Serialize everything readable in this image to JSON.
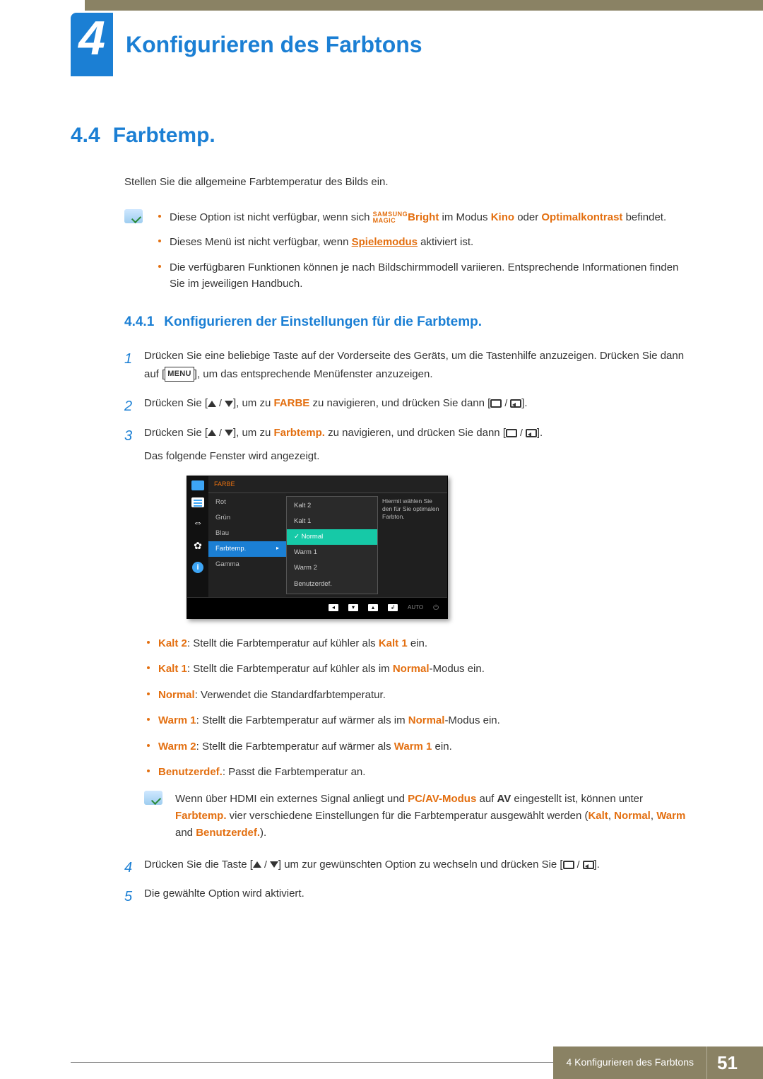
{
  "chapter": {
    "number": "4",
    "title": "Konfigurieren des Farbtons"
  },
  "section": {
    "number": "4.4",
    "title": "Farbtemp."
  },
  "intro": "Stellen Sie die allgemeine Farbtemperatur des Bilds ein.",
  "brand": {
    "samsung": "SAMSUNG",
    "magic": "MAGIC",
    "bright": "Bright"
  },
  "notes": {
    "n1a": "Diese Option ist nicht verfügbar, wenn sich ",
    "n1b": " im Modus ",
    "n1_kino": "Kino",
    "n1_or": " oder ",
    "n1_opt": "Optimalkontrast",
    "n1c": " befindet.",
    "n2a": "Dieses Menü ist nicht verfügbar, wenn ",
    "n2_game": "Spielemodus",
    "n2b": " aktiviert ist.",
    "n3": "Die verfügbaren Funktionen können je nach Bildschirmmodell variieren. Entsprechende Informationen finden Sie im jeweiligen Handbuch."
  },
  "subsection": {
    "number": "4.4.1",
    "title": "Konfigurieren der Einstellungen für die Farbtemp."
  },
  "steps": {
    "s1a": "Drücken Sie eine beliebige Taste auf der Vorderseite des Geräts, um die Tastenhilfe anzuzeigen. Drücken Sie dann auf [",
    "s1_menu": "MENU",
    "s1b": "], um das entsprechende Menüfenster anzuzeigen.",
    "s2a": "Drücken Sie [",
    "s2b": "], um zu ",
    "s2_farbe": "FARBE",
    "s2c": " zu navigieren, und drücken Sie dann [",
    "s2d": "].",
    "s3a": "Drücken Sie [",
    "s3b": "], um zu ",
    "s3_farbtemp": "Farbtemp.",
    "s3c": " zu navigieren, und drücken Sie dann [",
    "s3d": "].",
    "s3e": "Das folgende Fenster wird angezeigt.",
    "s4a": "Drücken Sie die Taste [",
    "s4b": "] um zur gewünschten Option zu wechseln und drücken Sie [",
    "s4c": "].",
    "s5": "Die gewählte Option wird aktiviert."
  },
  "osd": {
    "title": "FARBE",
    "left": [
      "Rot",
      "Grün",
      "Blau",
      "Farbtemp.",
      "Gamma"
    ],
    "mid": [
      "Kalt 2",
      "Kalt 1",
      "Normal",
      "Warm 1",
      "Warm 2",
      "Benutzerdef."
    ],
    "help": "Hiermit wählen Sie den für Sie optimalen Farbton.",
    "auto": "AUTO"
  },
  "options": {
    "kalt2_l": "Kalt 2",
    "kalt2_t": ": Stellt die Farbtemperatur auf kühler als ",
    "kalt2_r": "Kalt 1",
    "kalt2_e": " ein.",
    "kalt1_l": "Kalt 1",
    "kalt1_t": ": Stellt die Farbtemperatur auf kühler als im ",
    "kalt1_r": "Normal",
    "kalt1_e": "-Modus ein.",
    "normal_l": "Normal",
    "normal_t": ": Verwendet die Standardfarbtemperatur.",
    "warm1_l": "Warm 1",
    "warm1_t": ": Stellt die Farbtemperatur auf wärmer als im ",
    "warm1_r": "Normal",
    "warm1_e": "-Modus ein.",
    "warm2_l": "Warm 2",
    "warm2_t": ": Stellt die Farbtemperatur auf wärmer als ",
    "warm2_r": "Warm 1",
    "warm2_e": " ein.",
    "benutz_l": "Benutzerdef.",
    "benutz_t": ": Passt die Farbtemperatur an."
  },
  "note2": {
    "a": "Wenn über HDMI ein externes Signal anliegt und ",
    "pcav": "PC/AV-Modus",
    "b": " auf ",
    "av": "AV",
    "c": " eingestellt ist, können unter ",
    "farbtemp": "Farbtemp.",
    "d": " vier verschiedene Einstellungen für die Farbtemperatur ausgewählt werden (",
    "kalt": "Kalt",
    "comma": ", ",
    "normal": "Normal",
    "warm": "Warm",
    "and": " and ",
    "benutz": "Benutzerdef.",
    "end": ")."
  },
  "footer": {
    "chapter_ref": "4 Konfigurieren des Farbtons",
    "page": "51"
  }
}
